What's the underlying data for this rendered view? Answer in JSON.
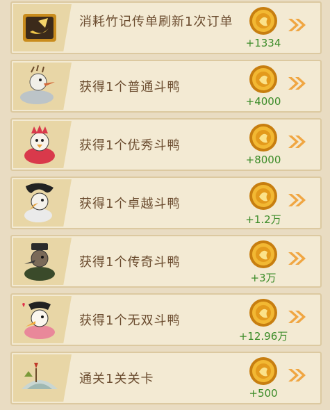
{
  "tasks": [
    {
      "label": "消耗竹记传单刷新1次订单",
      "reward": "+1334",
      "icon": "flyer-icon"
    },
    {
      "label": "获得1个普通斗鸭",
      "reward": "+4000",
      "icon": "duck-common-icon"
    },
    {
      "label": "获得1个优秀斗鸭",
      "reward": "+8000",
      "icon": "duck-excellent-icon"
    },
    {
      "label": "获得1个卓越斗鸭",
      "reward": "+1.2万",
      "icon": "duck-superior-icon"
    },
    {
      "label": "获得1个传奇斗鸭",
      "reward": "+3万",
      "icon": "duck-legendary-icon"
    },
    {
      "label": "获得1个无双斗鸭",
      "reward": "+12.96万",
      "icon": "duck-peerless-icon"
    },
    {
      "label": "通关1关关卡",
      "reward": "+500",
      "icon": "level-clear-icon"
    }
  ],
  "colors": {
    "panel": "#f3ead3",
    "reward_green": "#3a8b27",
    "coin_gold": "#e9a61a",
    "arrow_orange": "#f0a642"
  }
}
